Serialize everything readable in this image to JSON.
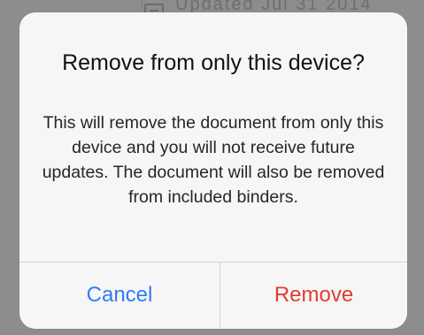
{
  "background": {
    "row_text": "Updated Jul 31 2014"
  },
  "alert": {
    "title": "Remove from only this device?",
    "message": "This will remove the document from only this device and you will not receive future updates. The document will also be removed from included binders.",
    "buttons": {
      "cancel": {
        "label": "Cancel",
        "color": "#2f7cf6"
      },
      "remove": {
        "label": "Remove",
        "color": "#e43a2f"
      }
    }
  }
}
